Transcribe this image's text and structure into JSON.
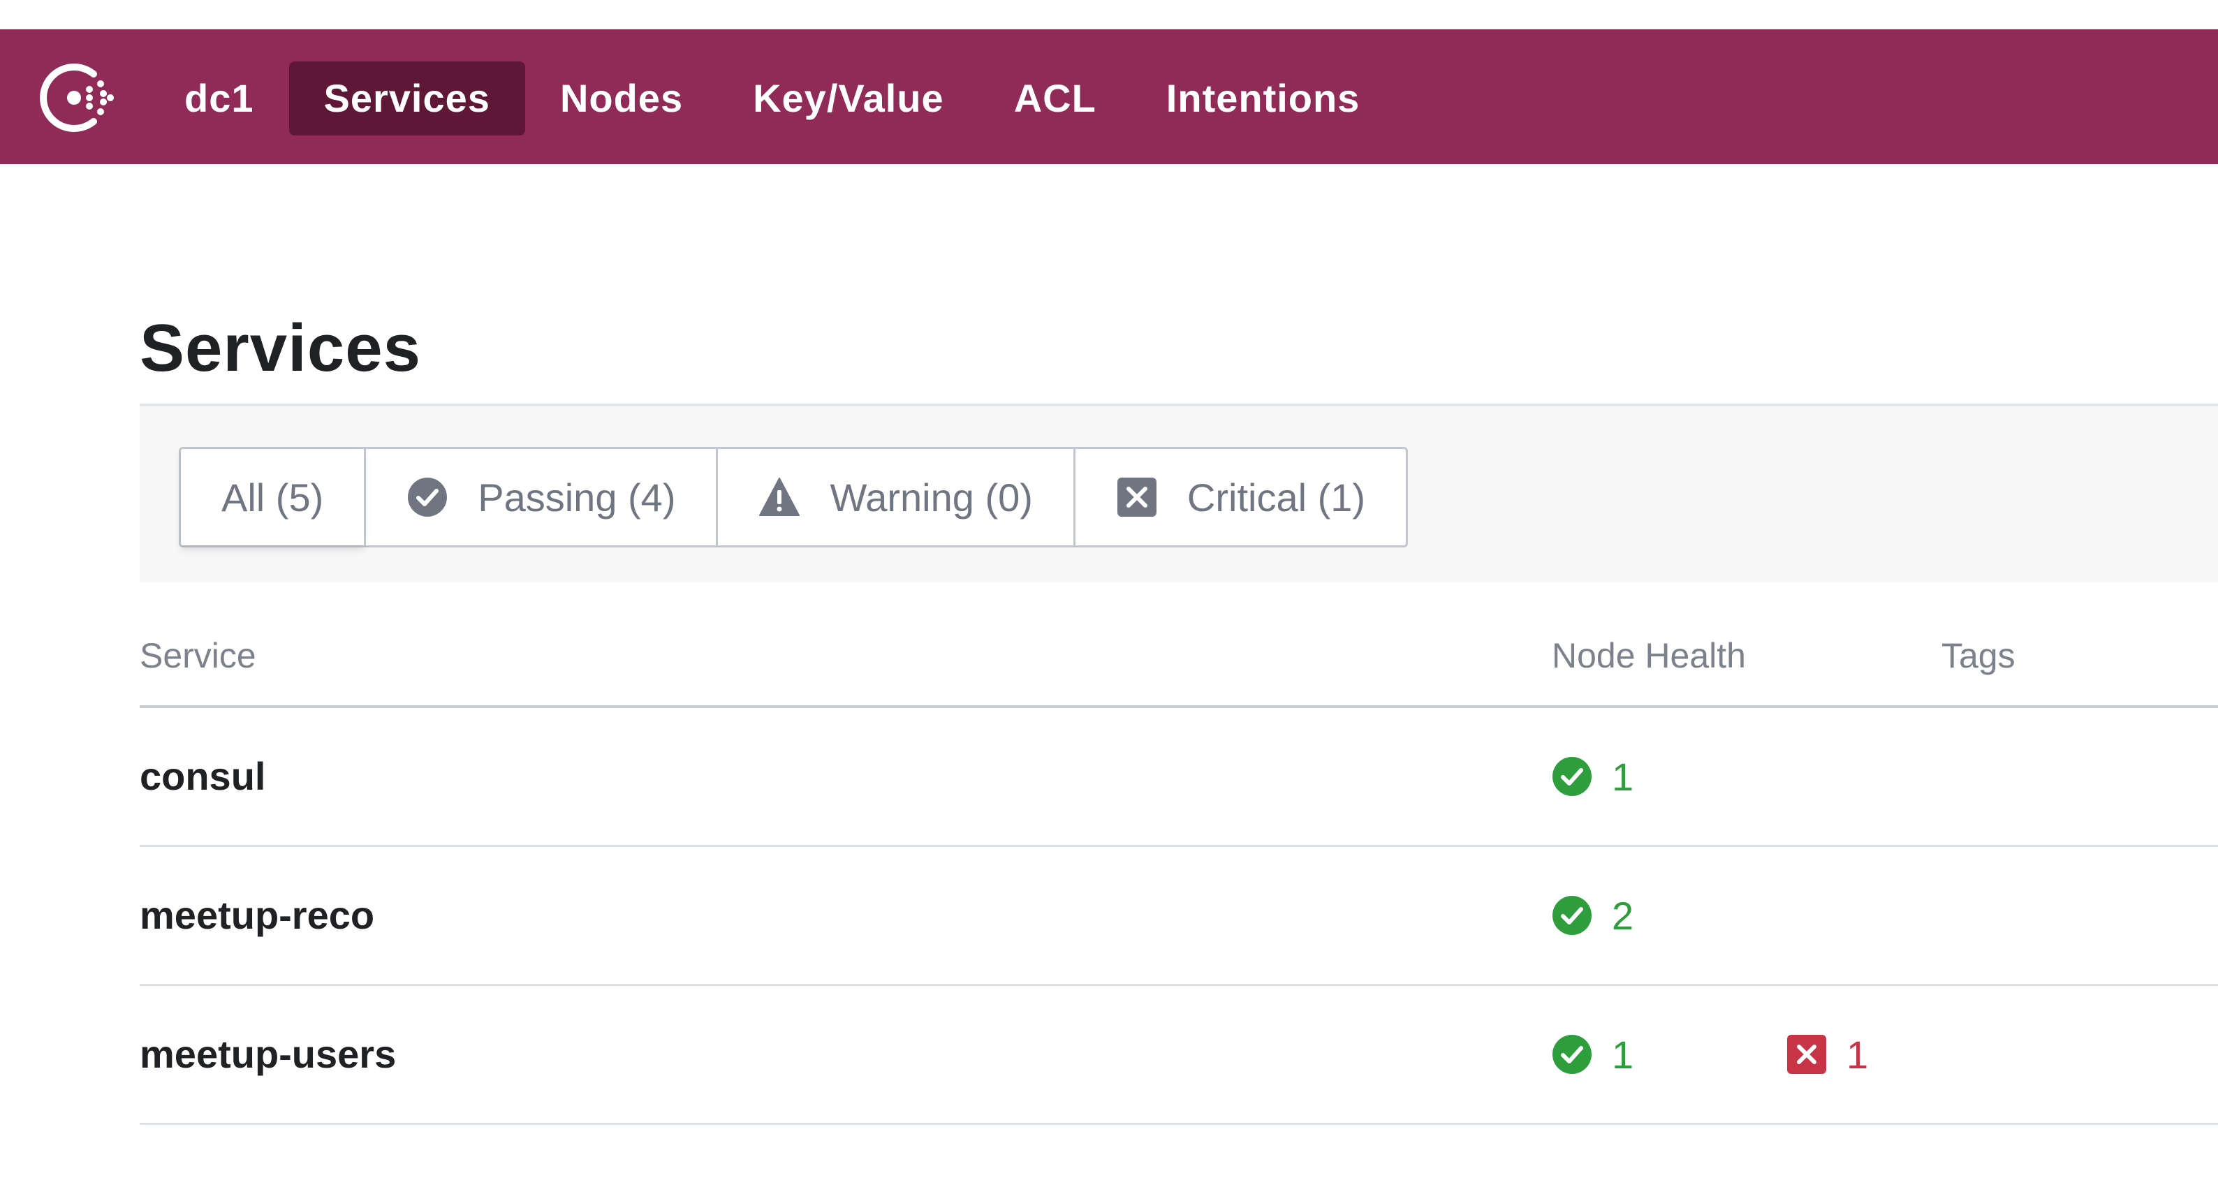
{
  "nav": {
    "datacenter": "dc1",
    "items": [
      "Services",
      "Nodes",
      "Key/Value",
      "ACL",
      "Intentions"
    ],
    "active": "Services"
  },
  "page": {
    "title": "Services"
  },
  "filters": [
    {
      "label": "All (5)",
      "icon": "none"
    },
    {
      "label": "Passing (4)",
      "icon": "check-circle-icon"
    },
    {
      "label": "Warning (0)",
      "icon": "warning-triangle-icon"
    },
    {
      "label": "Critical (1)",
      "icon": "critical-x-icon"
    }
  ],
  "table": {
    "headers": {
      "service": "Service",
      "health": "Node Health",
      "tags": "Tags"
    },
    "rows": [
      {
        "service": "consul",
        "passing": "1",
        "critical": ""
      },
      {
        "service": "meetup-reco",
        "passing": "2",
        "critical": ""
      },
      {
        "service": "meetup-users",
        "passing": "1",
        "critical": "1"
      }
    ]
  },
  "colors": {
    "brand": "#8f2b56",
    "nav_active": "#5e1735",
    "passing": "#2e9e3d",
    "critical": "#c73445"
  }
}
